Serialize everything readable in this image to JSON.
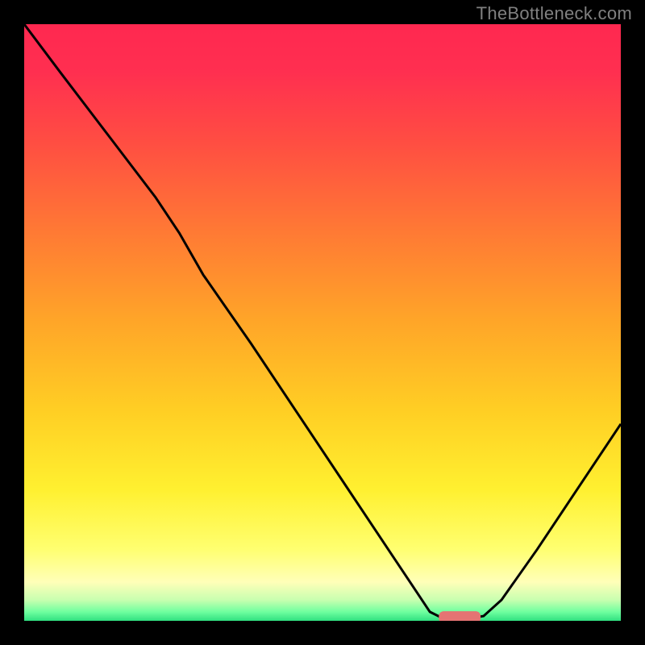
{
  "watermark": "TheBottleneck.com",
  "chart_data": {
    "type": "line",
    "title": "",
    "xlabel": "",
    "ylabel": "",
    "xlim": [
      0,
      100
    ],
    "ylim": [
      0,
      100
    ],
    "gradient_stops": [
      {
        "offset": 0.0,
        "color": "#ff2850"
      },
      {
        "offset": 0.08,
        "color": "#ff2f50"
      },
      {
        "offset": 0.2,
        "color": "#ff4e42"
      },
      {
        "offset": 0.35,
        "color": "#ff7a34"
      },
      {
        "offset": 0.5,
        "color": "#ffa628"
      },
      {
        "offset": 0.65,
        "color": "#ffcf24"
      },
      {
        "offset": 0.78,
        "color": "#fff030"
      },
      {
        "offset": 0.88,
        "color": "#ffff70"
      },
      {
        "offset": 0.935,
        "color": "#ffffb8"
      },
      {
        "offset": 0.965,
        "color": "#c8ffb0"
      },
      {
        "offset": 0.985,
        "color": "#6fff9f"
      },
      {
        "offset": 1.0,
        "color": "#30e080"
      }
    ],
    "series": [
      {
        "name": "bottleneck-curve",
        "color": "#000000",
        "stroke_width": 3,
        "points": [
          {
            "x": 0.0,
            "y": 100.0
          },
          {
            "x": 6.0,
            "y": 92.0
          },
          {
            "x": 14.0,
            "y": 81.5
          },
          {
            "x": 22.0,
            "y": 71.0
          },
          {
            "x": 26.0,
            "y": 65.0
          },
          {
            "x": 30.0,
            "y": 58.0
          },
          {
            "x": 38.0,
            "y": 46.5
          },
          {
            "x": 46.0,
            "y": 34.5
          },
          {
            "x": 54.0,
            "y": 22.5
          },
          {
            "x": 62.0,
            "y": 10.5
          },
          {
            "x": 66.0,
            "y": 4.5
          },
          {
            "x": 68.0,
            "y": 1.5
          },
          {
            "x": 70.0,
            "y": 0.5
          },
          {
            "x": 74.0,
            "y": 0.3
          },
          {
            "x": 77.0,
            "y": 0.8
          },
          {
            "x": 80.0,
            "y": 3.5
          },
          {
            "x": 86.0,
            "y": 12.0
          },
          {
            "x": 92.0,
            "y": 21.0
          },
          {
            "x": 100.0,
            "y": 33.0
          }
        ]
      }
    ],
    "marker": {
      "name": "target-marker",
      "color": "#e57373",
      "x_center": 73.0,
      "x_halfwidth": 3.5,
      "y": 0.6,
      "height": 2.0
    }
  }
}
